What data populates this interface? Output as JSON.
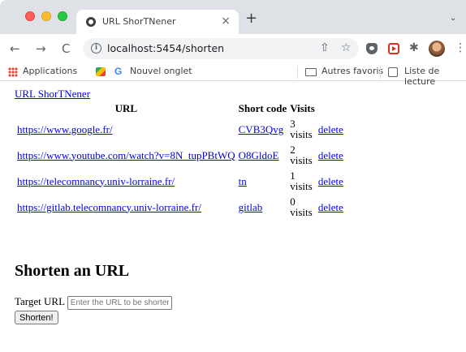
{
  "browser": {
    "tab_title": "URL ShorTNener",
    "tab_close": "×",
    "new_tab": "+",
    "tab_dropdown": "⌄",
    "url": "localhost:5454/shorten",
    "bookmarks": {
      "apps": "Applications",
      "newtab": "Nouvel onglet",
      "favorites": "Autres favoris",
      "reading_list": "Liste de lecture"
    },
    "icons": {
      "back": "←",
      "forward": "→",
      "reload": "C",
      "share": "⇧",
      "star": "☆",
      "puzzle": "✱",
      "menu": "⋮",
      "info": "i"
    }
  },
  "page": {
    "home_link": "URL ShorTNener",
    "table": {
      "headers": [
        "URL",
        "Short code",
        "Visits"
      ],
      "rows": [
        {
          "url": "https://www.google.fr/",
          "code": "CVB3Qvg",
          "visits_count": "3",
          "visits_word": "visits",
          "action": "delete"
        },
        {
          "url": "https://www.youtube.com/watch?v=8N_tupPBtWQ",
          "code": "O8GldoE",
          "visits_count": "2",
          "visits_word": "visits",
          "action": "delete"
        },
        {
          "url": "https://telecomnancy.univ-lorraine.fr/",
          "code": "tn",
          "visits_count": "1",
          "visits_word": "visits",
          "action": "delete"
        },
        {
          "url": "https://gitlab.telecomnancy.univ-lorraine.fr/",
          "code": "gitlab",
          "visits_count": "0",
          "visits_word": "visits",
          "action": "delete"
        }
      ]
    },
    "form": {
      "title": "Shorten an URL",
      "target_label": "Target URL",
      "target_placeholder": "Enter the URL to be shortened",
      "submit_label": "Shorten!"
    }
  }
}
